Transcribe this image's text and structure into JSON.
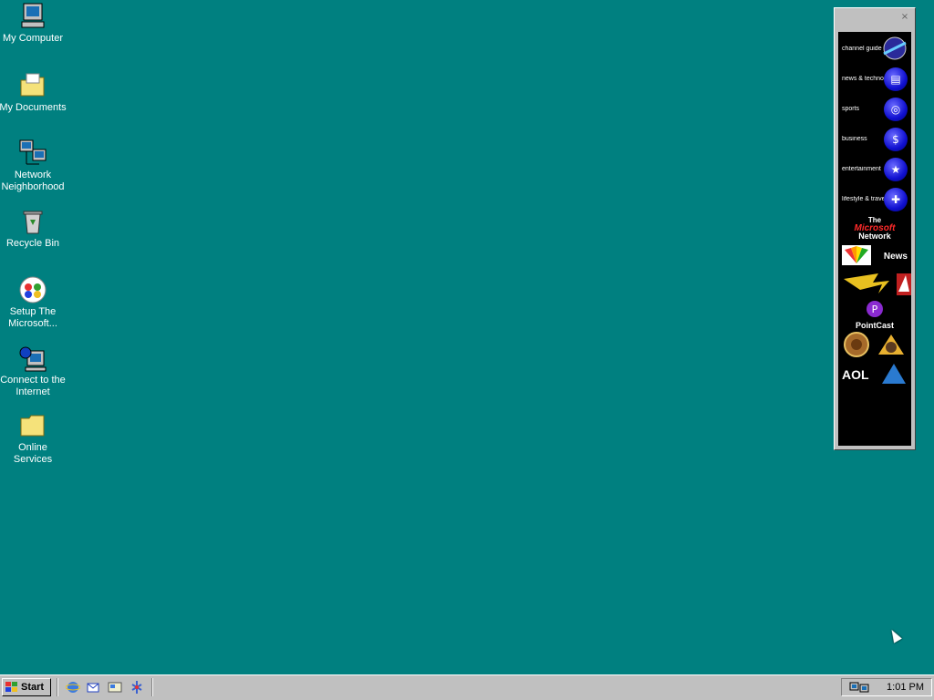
{
  "desktop": {
    "icons": [
      {
        "id": "my-computer",
        "label": "My Computer"
      },
      {
        "id": "my-documents",
        "label": "My Documents"
      },
      {
        "id": "network",
        "label": "Network Neighborhood"
      },
      {
        "id": "recycle-bin",
        "label": "Recycle Bin"
      },
      {
        "id": "msn",
        "label": "Setup The Microsoft..."
      },
      {
        "id": "connect",
        "label": "Connect to the Internet"
      },
      {
        "id": "online-services",
        "label": "Online Services"
      }
    ]
  },
  "channel_bar": {
    "close_glyph": "×",
    "items": [
      {
        "label": "channel guide"
      },
      {
        "label": "news & technology"
      },
      {
        "label": "sports"
      },
      {
        "label": "business"
      },
      {
        "label": "entertainment"
      },
      {
        "label": "lifestyle & travel"
      }
    ],
    "msn": {
      "line1": "The",
      "line2": "Microsoft",
      "line3": "Network"
    },
    "logos": {
      "nbc": "NBC",
      "news": "News",
      "pointcast": "PointCast",
      "aol": "AOL"
    }
  },
  "taskbar": {
    "start_label": "Start",
    "quick_launch": [
      "internet-explorer-icon",
      "outlook-express-icon",
      "show-desktop-icon",
      "channels-icon"
    ],
    "clock": "1:01 PM"
  },
  "colors": {
    "desktop": "#008080",
    "chrome": "#c0c0c0"
  }
}
